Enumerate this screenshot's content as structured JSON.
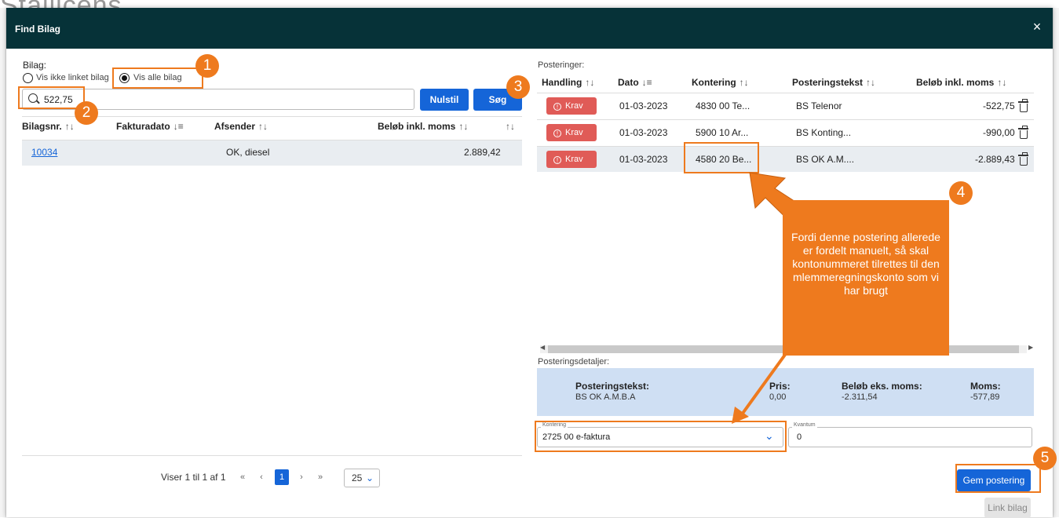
{
  "background": {
    "title": "Stallicens"
  },
  "modal": {
    "title": "Find Bilag",
    "close": "×"
  },
  "left": {
    "bilag_label": "Bilag:",
    "radio_linked": "Vis ikke linket bilag",
    "radio_all": "Vis alle bilag",
    "search_value": "522,75",
    "reset_button": "Nulstil",
    "search_button": "Søg",
    "columns": [
      "Bilagsnr.",
      "Fakturadato",
      "Afsender",
      "Beløb inkl. moms"
    ],
    "sort_icons": [
      "↑↓",
      "↓≡",
      "↑↓",
      "↑↓",
      "↑↓"
    ],
    "rows": [
      {
        "bilagsnr": "10034",
        "fakturadato": "",
        "afsender": "OK, diesel",
        "belob": "2.889,42"
      }
    ],
    "pager": {
      "info": "Viser 1 til 1 af 1",
      "first": "«",
      "prev": "‹",
      "page": "1",
      "next": "›",
      "last": "»",
      "page_size": "25"
    }
  },
  "right": {
    "posteringer_label": "Posteringer:",
    "columns": [
      "Handling",
      "Dato",
      "Kontering",
      "Posteringstekst",
      "Beløb inkl. moms"
    ],
    "sort_icons": [
      "↑↓",
      "↓≡",
      "↑↓",
      "↑↓",
      "↑↓"
    ],
    "rows": [
      {
        "handling": "Krav",
        "dato": "01-03-2023",
        "kontering": "4830 00 Te...",
        "tekst": "BS Telenor",
        "belob": "-522,75"
      },
      {
        "handling": "Krav",
        "dato": "01-03-2023",
        "kontering": "5900 10 Ar...",
        "tekst": "BS Konting...",
        "belob": "-990,00"
      },
      {
        "handling": "Krav",
        "dato": "01-03-2023",
        "kontering": "4580 20 Be...",
        "tekst": "BS OK A.M....",
        "belob": "-2.889,43"
      }
    ],
    "detaljer_label": "Posteringsdetaljer:",
    "detaljer": {
      "tekst_label": "Posteringstekst:",
      "tekst_value": "BS OK A.M.B.A",
      "pris_label": "Pris:",
      "pris_value": "0,00",
      "eks_label": "Beløb eks. moms:",
      "eks_value": "-2.311,54",
      "moms_label": "Moms:",
      "moms_value": "-577,89"
    },
    "kontering_label": "Kontering",
    "kontering_value": "2725 00 e-faktura",
    "kvantum_label": "Kvantum",
    "kvantum_value": "0",
    "save_button": "Gem postering",
    "link_button": "Link bilag"
  },
  "annotations": {
    "badges": [
      "1",
      "2",
      "3",
      "4",
      "5"
    ],
    "callout": "Fordi denne postering allerede er fordelt manuelt, så skal kontonummeret tilrettes til den mlemmeregningskonto som vi har brugt",
    "accent_color": "#ee7a1e"
  },
  "colors": {
    "header": "#063238",
    "primary": "#1565d8",
    "danger": "#e05b57"
  }
}
